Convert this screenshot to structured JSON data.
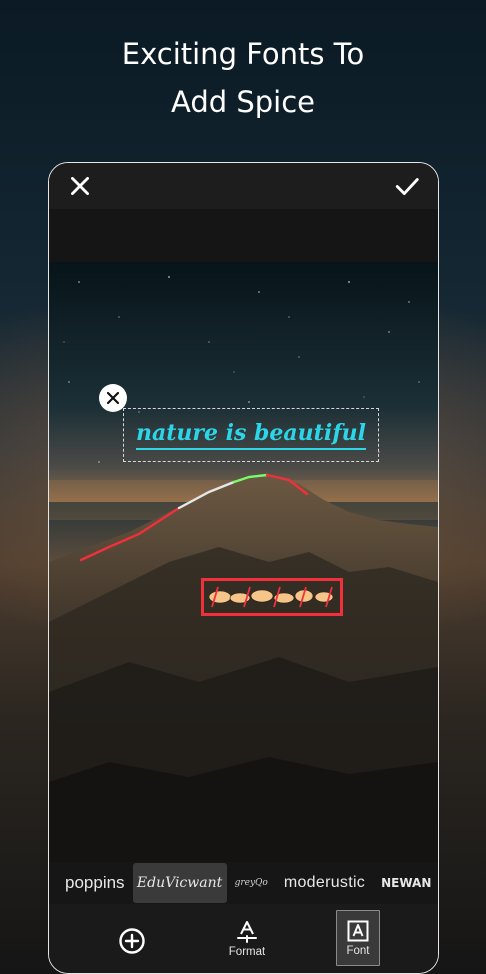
{
  "headline": {
    "line1": "Exciting Fonts To",
    "line2": "Add Spice"
  },
  "editor": {
    "close_icon": "close-icon",
    "confirm_icon": "check-icon",
    "text_layer": "nature is beautiful",
    "text_color": "#2cd6e8",
    "remove_icon": "close-circle-icon"
  },
  "font_list": [
    "poppins",
    "EduVicwant",
    "greyQo",
    "moderustic",
    "NEWAN"
  ],
  "selected_font": "EduVicwant",
  "toolbar": {
    "add_icon": "plus-circle-icon",
    "format_label": "Format",
    "font_label": "Font"
  },
  "colors": {
    "accent_red": "#f0303a",
    "accent_cyan": "#2cd6e8",
    "background": "#161616"
  }
}
